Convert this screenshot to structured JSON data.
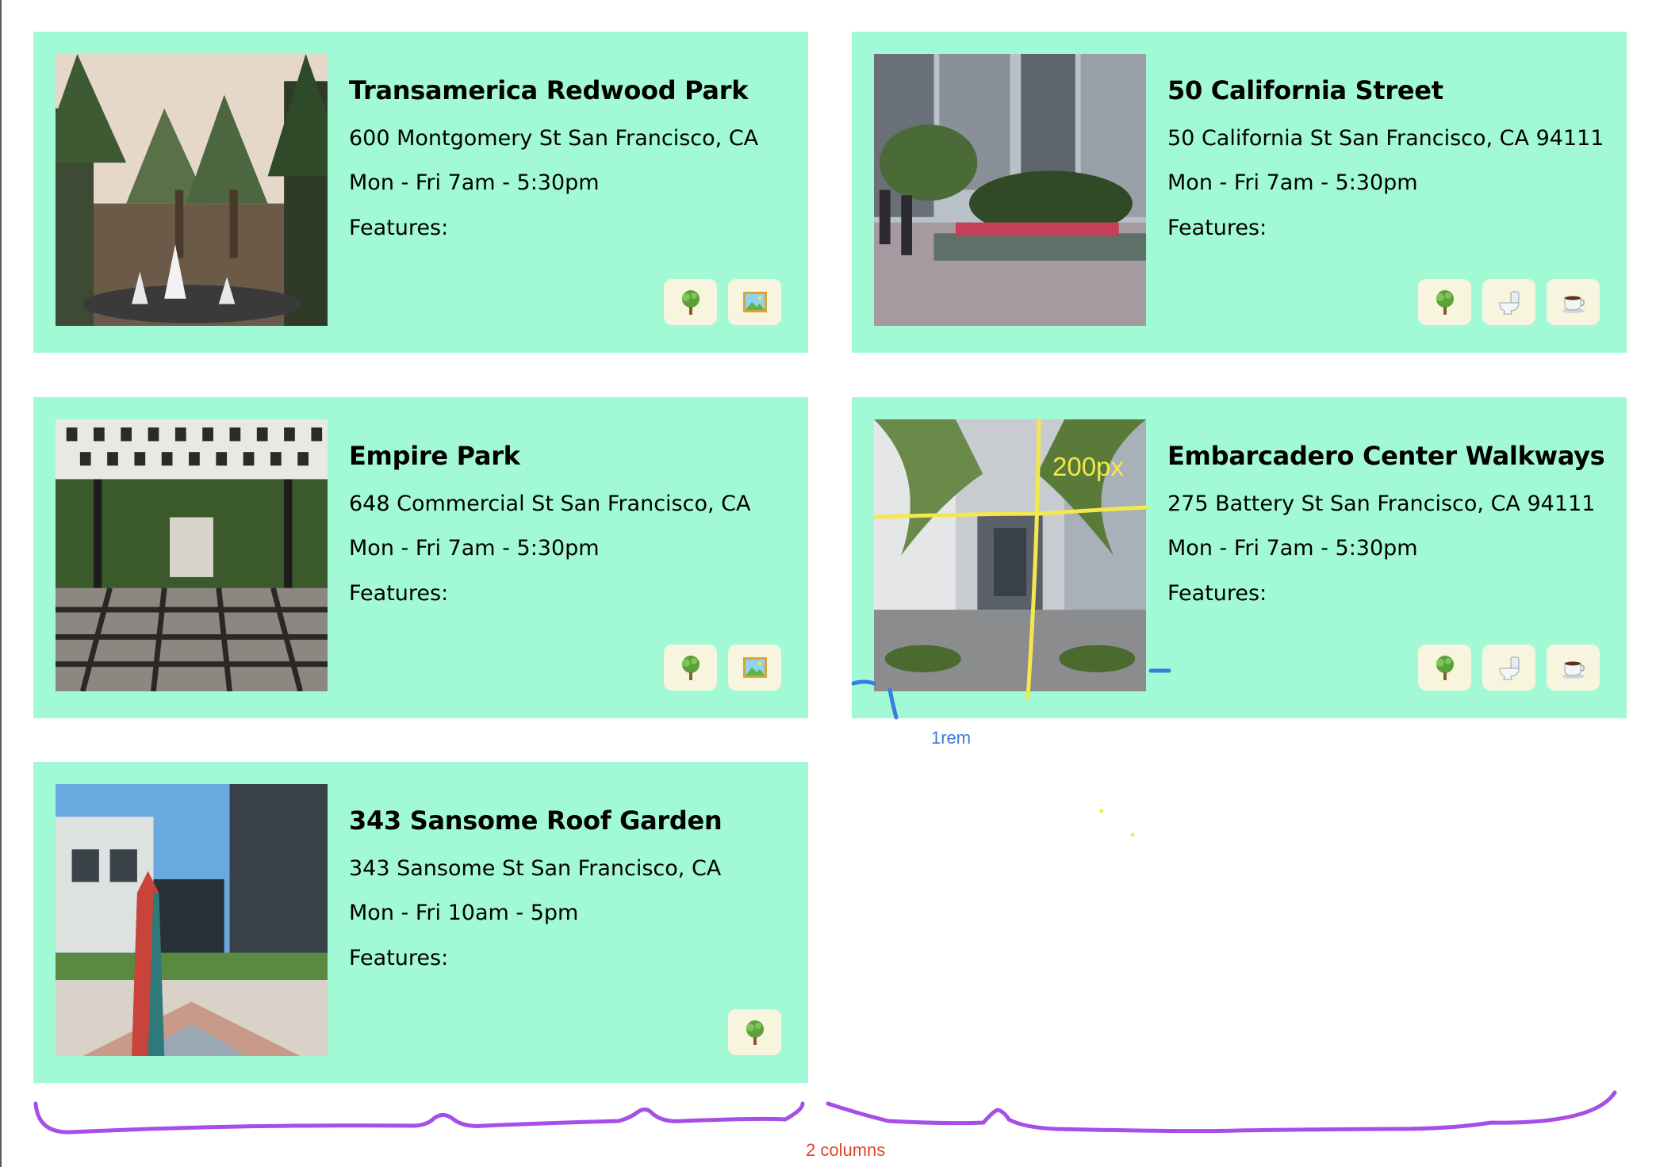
{
  "cards": [
    {
      "name": "Transamerica Redwood Park",
      "address": "600 Montgomery St San Francisco, CA",
      "hours": "Mon - Fri 7am - 5:30pm",
      "features_label": "Features:",
      "feature_icons": [
        "tree-icon",
        "framed-picture-icon"
      ]
    },
    {
      "name": "50 California Street",
      "address": "50 California St San Francisco, CA 94111",
      "hours": "Mon - Fri 7am - 5:30pm",
      "features_label": "Features:",
      "feature_icons": [
        "tree-icon",
        "toilet-icon",
        "coffee-icon"
      ]
    },
    {
      "name": "Empire Park",
      "address": "648 Commercial St San Francisco, CA",
      "hours": "Mon - Fri 7am - 5:30pm",
      "features_label": "Features:",
      "feature_icons": [
        "tree-icon",
        "framed-picture-icon"
      ]
    },
    {
      "name": "Embarcadero Center Walkways",
      "address": "275 Battery St San Francisco, CA 94111",
      "hours": "Mon - Fri 7am - 5:30pm",
      "features_label": "Features:",
      "feature_icons": [
        "tree-icon",
        "toilet-icon",
        "coffee-icon"
      ]
    },
    {
      "name": "343 Sansome Roof Garden",
      "address": "343 Sansome St San Francisco, CA",
      "hours": "Mon - Fri 10am - 5pm",
      "features_label": "Features:",
      "feature_icons": [
        "tree-icon"
      ]
    }
  ],
  "annotations": {
    "image_size": "200px",
    "gap": "1rem",
    "columns": "2 columns"
  },
  "colors": {
    "card_background": "#a2f9d6",
    "feature_badge": "#f7f5dd",
    "annotation_yellow": "#f5e84a",
    "annotation_blue": "#3a7de0",
    "annotation_purple": "#a54ee8",
    "annotation_red": "#e0442b"
  }
}
